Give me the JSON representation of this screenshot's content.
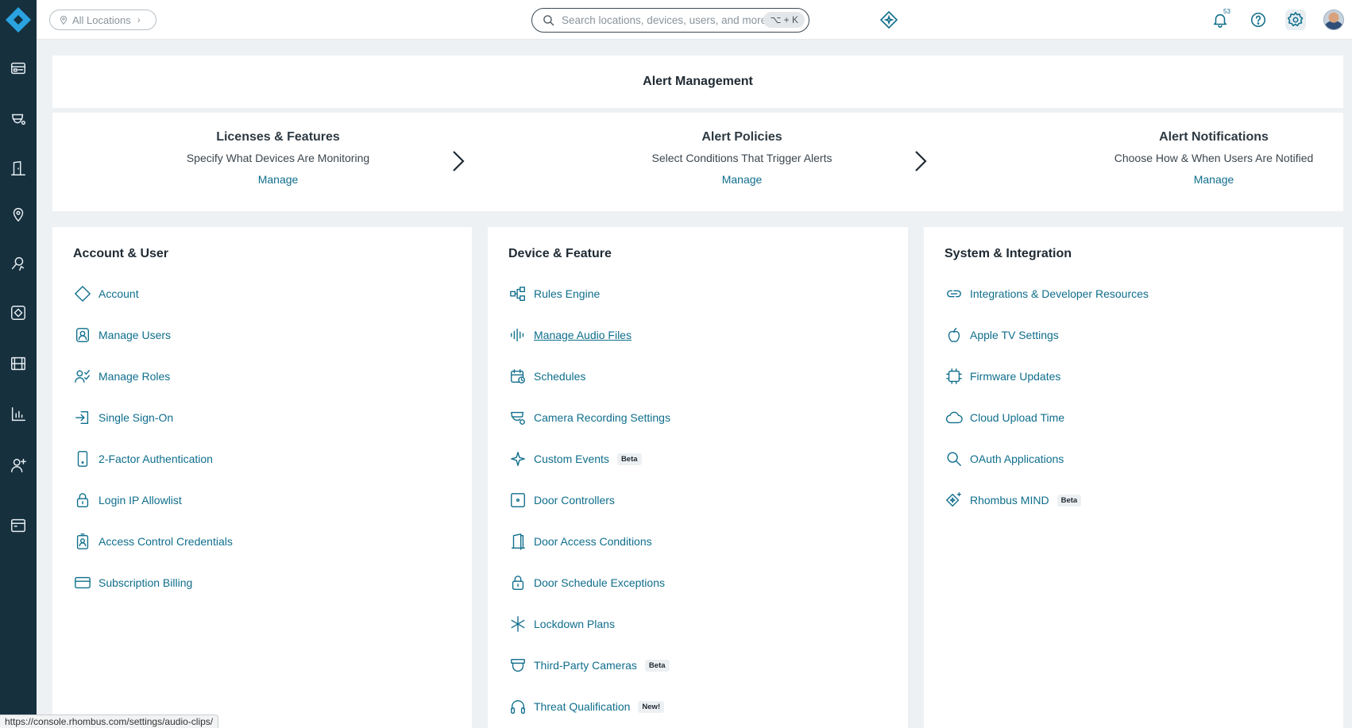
{
  "topbar": {
    "location_label": "All Locations",
    "search_placeholder": "Search locations, devices, users, and more",
    "shortcut": "⌥ + K",
    "notification_count": "53"
  },
  "header": {
    "title": "Alert Management"
  },
  "steps": [
    {
      "title": "Licenses & Features",
      "desc": "Specify What Devices Are Monitoring",
      "link": "Manage"
    },
    {
      "title": "Alert Policies",
      "desc": "Select Conditions That Trigger Alerts",
      "link": "Manage"
    },
    {
      "title": "Alert Notifications",
      "desc": "Choose How & When Users Are Notified",
      "link": "Manage"
    }
  ],
  "account_user": {
    "heading": "Account & User",
    "items": [
      {
        "label": "Account",
        "icon": "diamond-icon"
      },
      {
        "label": "Manage Users",
        "icon": "user-badge-icon"
      },
      {
        "label": "Manage Roles",
        "icon": "user-checklist-icon"
      },
      {
        "label": "Single Sign-On",
        "icon": "sign-in-icon"
      },
      {
        "label": "2-Factor Authentication",
        "icon": "phone-icon"
      },
      {
        "label": "Login IP Allowlist",
        "icon": "lock-icon"
      },
      {
        "label": "Access Control Credentials",
        "icon": "id-badge-icon"
      },
      {
        "label": "Subscription Billing",
        "icon": "credit-card-icon"
      }
    ]
  },
  "device_feature": {
    "heading": "Device & Feature",
    "items": [
      {
        "label": "Rules Engine",
        "icon": "flow-icon"
      },
      {
        "label": "Manage Audio Files",
        "icon": "audio-wave-icon"
      },
      {
        "label": "Schedules",
        "icon": "calendar-clock-icon"
      },
      {
        "label": "Camera Recording Settings",
        "icon": "camera-settings-icon"
      },
      {
        "label": "Custom Events",
        "icon": "sparkle-icon",
        "tag": "Beta"
      },
      {
        "label": "Door Controllers",
        "icon": "door-controller-icon"
      },
      {
        "label": "Door Access Conditions",
        "icon": "door-icon"
      },
      {
        "label": "Door Schedule Exceptions",
        "icon": "lock-icon"
      },
      {
        "label": "Lockdown Plans",
        "icon": "asterisk-icon"
      },
      {
        "label": "Third-Party Cameras",
        "icon": "dome-camera-icon",
        "tag": "Beta"
      },
      {
        "label": "Threat Qualification",
        "icon": "headset-icon",
        "tag": "New!"
      }
    ]
  },
  "system_integration": {
    "heading": "System & Integration",
    "items": [
      {
        "label": "Integrations & Developer Resources",
        "icon": "link-icon"
      },
      {
        "label": "Apple TV Settings",
        "icon": "apple-icon"
      },
      {
        "label": "Firmware Updates",
        "icon": "chip-icon"
      },
      {
        "label": "Cloud Upload Time",
        "icon": "cloud-icon"
      },
      {
        "label": "OAuth Applications",
        "icon": "search-key-icon"
      },
      {
        "label": "Rhombus MIND",
        "icon": "mind-sparkle-icon",
        "tag": "Beta"
      }
    ]
  },
  "statusbar": {
    "url": "https://console.rhombus.com/settings/audio-clips/"
  }
}
